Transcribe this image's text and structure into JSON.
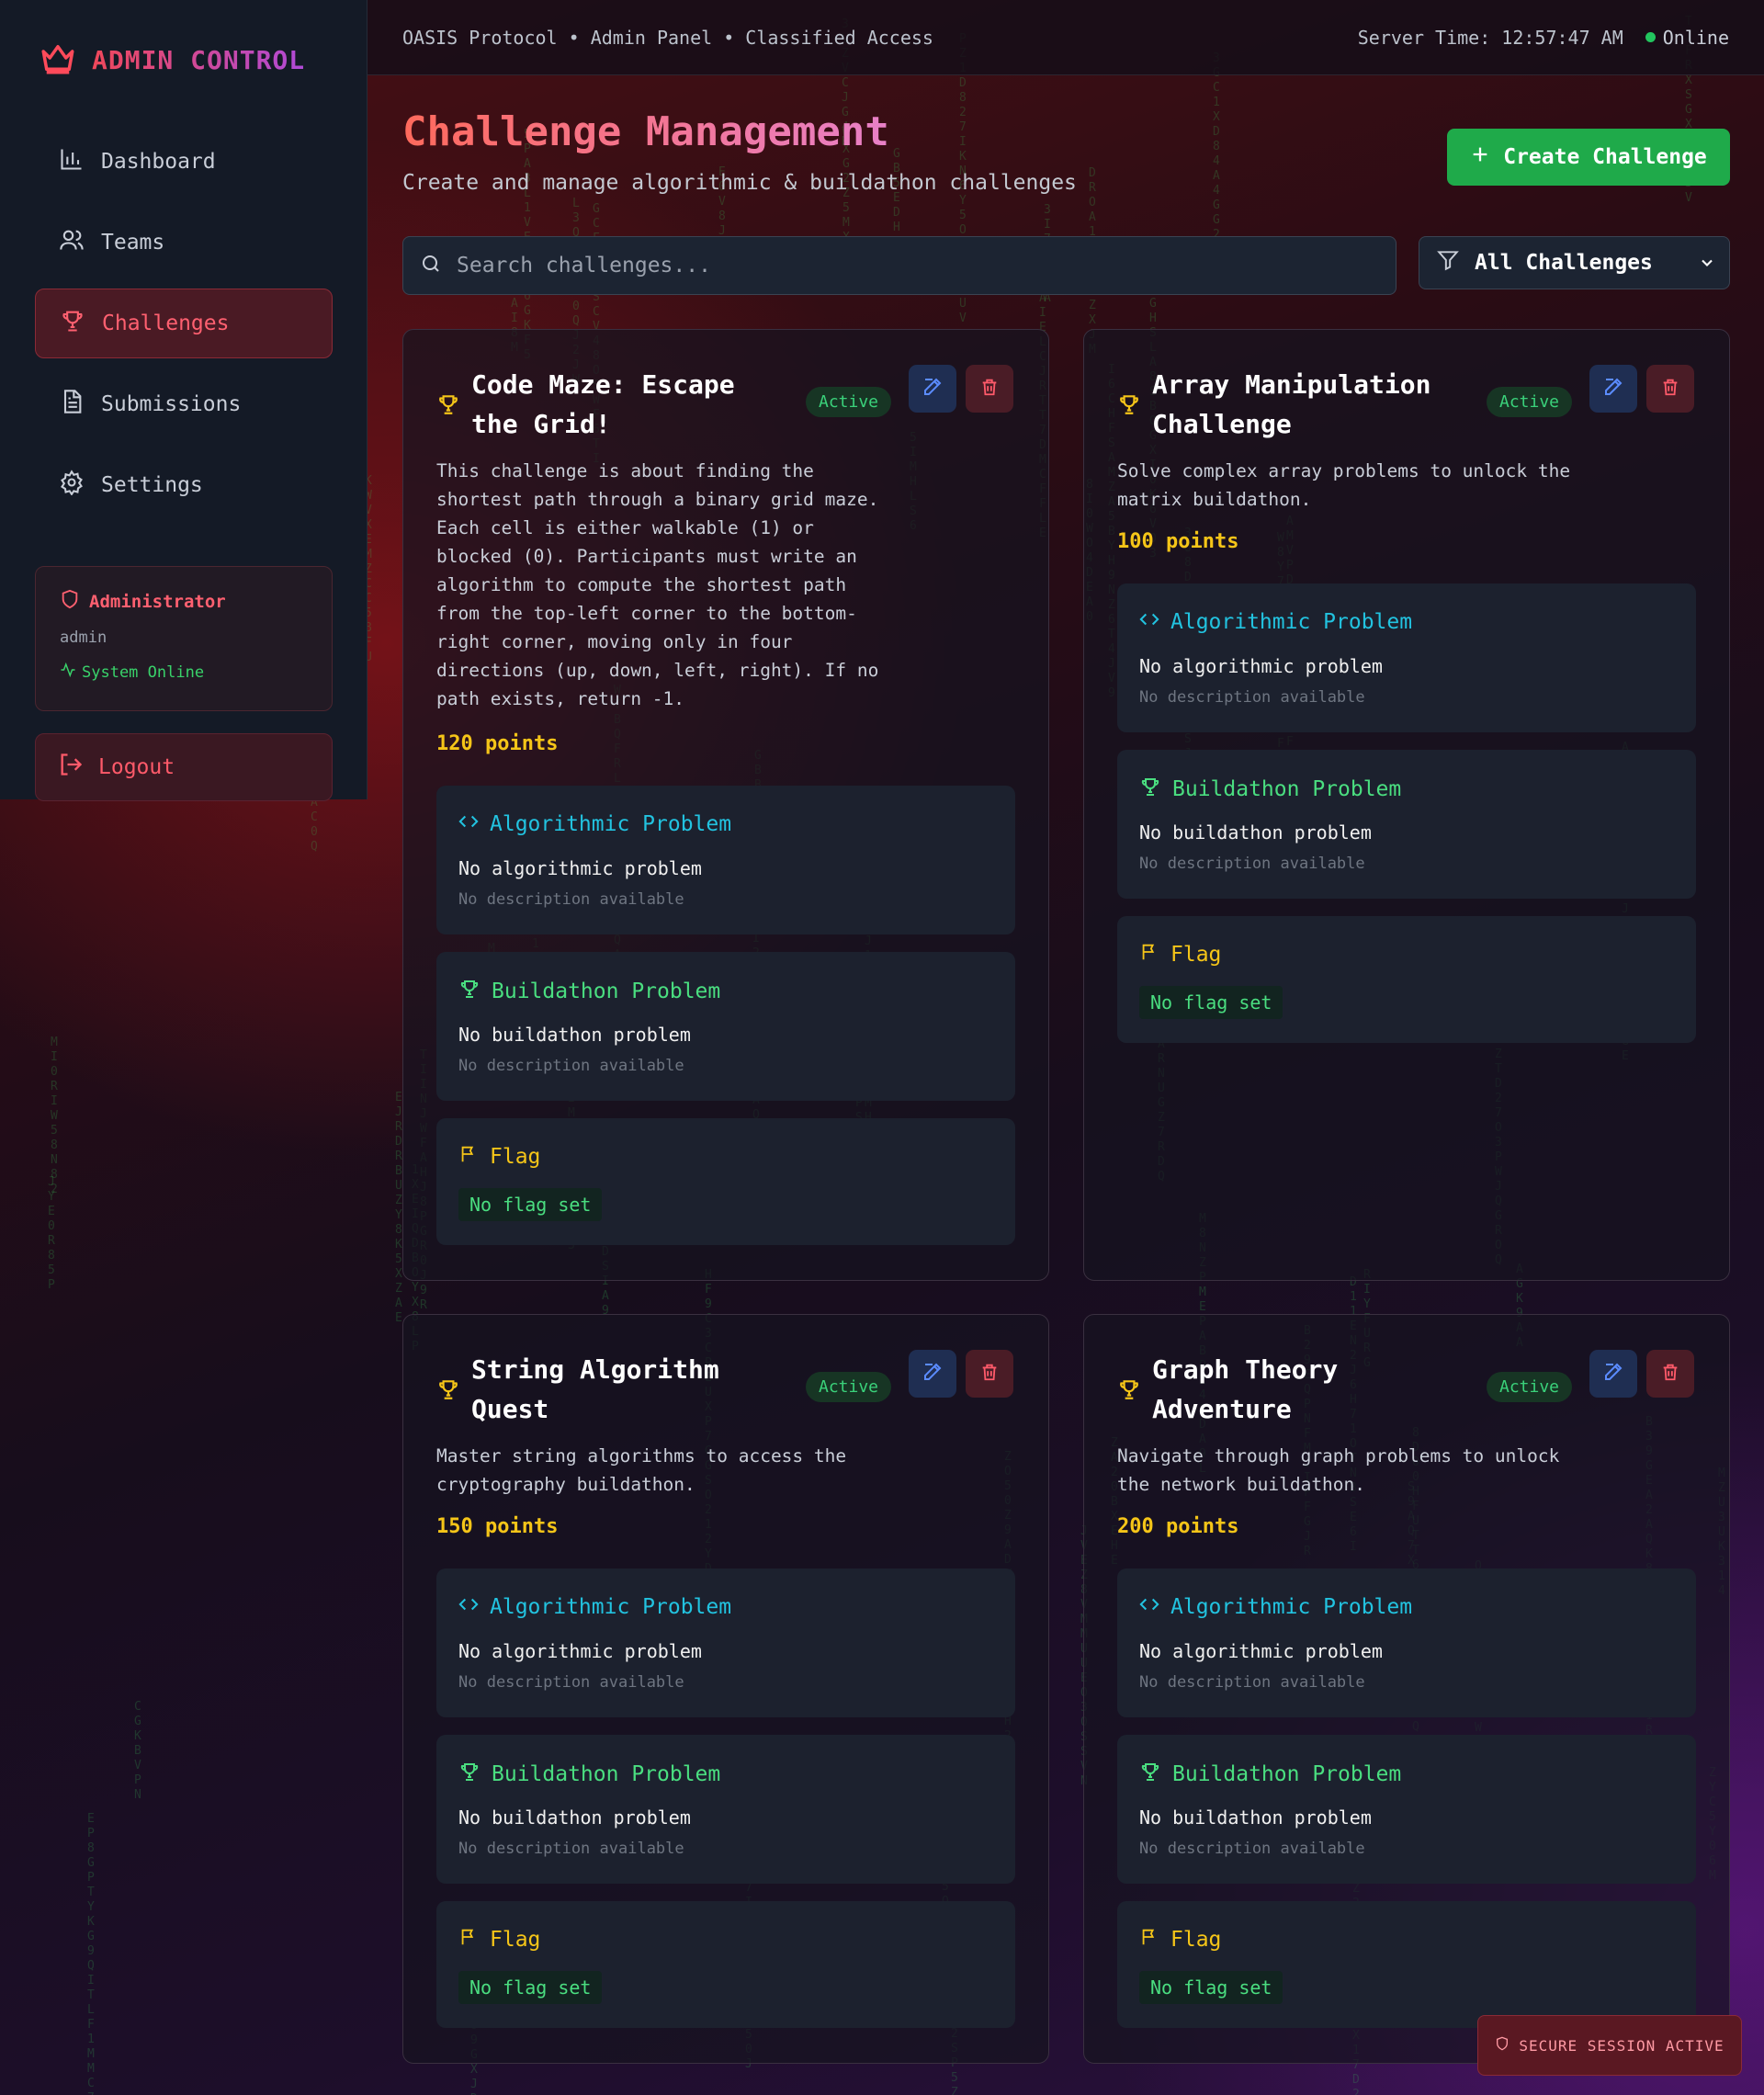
{
  "brand": {
    "title": "ADMIN CONTROL"
  },
  "nav": [
    {
      "label": "Dashboard",
      "icon": "bar-chart-icon",
      "active": false
    },
    {
      "label": "Teams",
      "icon": "users-icon",
      "active": false
    },
    {
      "label": "Challenges",
      "icon": "trophy-icon",
      "active": true
    },
    {
      "label": "Submissions",
      "icon": "file-icon",
      "active": false
    },
    {
      "label": "Settings",
      "icon": "gear-icon",
      "active": false
    }
  ],
  "admin": {
    "role": "Administrator",
    "username": "admin",
    "status": "System Online"
  },
  "logout_label": "Logout",
  "topbar": {
    "breadcrumb": "OASIS Protocol • Admin Panel • Classified Access",
    "server_time": "Server Time: 12:57:47 AM",
    "status": "Online"
  },
  "header": {
    "title": "Challenge Management",
    "subtitle": "Create and manage algorithmic & buildathon challenges",
    "create_label": "Create Challenge"
  },
  "search": {
    "placeholder": "Search challenges..."
  },
  "filter": {
    "selected": "All Challenges"
  },
  "labels": {
    "algorithmic": "Algorithmic Problem",
    "buildathon": "Buildathon Problem",
    "flag": "Flag",
    "no_algo": "No algorithmic problem",
    "no_build": "No buildathon problem",
    "no_desc": "No description available",
    "no_flag": "No flag set"
  },
  "challenges": [
    {
      "title": "Code Maze: Escape the Grid!",
      "status": "Active",
      "description": "This challenge is about finding the shortest path through a binary grid maze. Each cell is either walkable (1) or blocked (0). Participants must write an algorithm to compute the shortest path from the top-left corner to the bottom-right corner, moving only in four directions (up, down, left, right). If no path exists, return -1.",
      "points": "120 points"
    },
    {
      "title": "Array Manipulation Challenge",
      "status": "Active",
      "description": "Solve complex array problems to unlock the matrix buildathon.",
      "points": "100 points"
    },
    {
      "title": "String Algorithm Quest",
      "status": "Active",
      "description": "Master string algorithms to access the cryptography buildathon.",
      "points": "150 points"
    },
    {
      "title": "Graph Theory Adventure",
      "status": "Active",
      "description": "Navigate through graph problems to unlock the network buildathon.",
      "points": "200 points"
    }
  ],
  "secure_badge": "SECURE SESSION ACTIVE",
  "colors": {
    "accent": "#ff5a6a",
    "success": "#1faa4a",
    "points": "#f5c518",
    "algo": "#22c3e0",
    "build": "#4ade80"
  }
}
